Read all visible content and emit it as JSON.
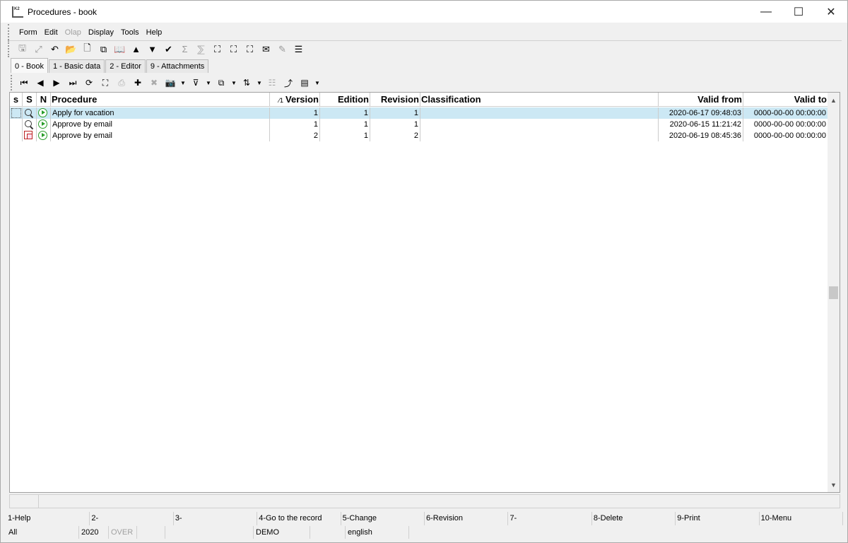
{
  "window": {
    "title": "Procedures - book",
    "icon_name": "k2-app-icon",
    "controls": {
      "minimize": "—",
      "maximize": "☐",
      "close": "✕"
    }
  },
  "menu": {
    "items": [
      {
        "label": "Form",
        "enabled": true
      },
      {
        "label": "Edit",
        "enabled": true
      },
      {
        "label": "Olap",
        "enabled": false
      },
      {
        "label": "Display",
        "enabled": true
      },
      {
        "label": "Tools",
        "enabled": true
      },
      {
        "label": "Help",
        "enabled": true
      }
    ]
  },
  "toolbar": {
    "icons": [
      {
        "name": "save-icon",
        "glyph": "🖫",
        "enabled": false
      },
      {
        "name": "save-as-icon",
        "glyph": "⤢",
        "enabled": false
      },
      {
        "name": "undo-icon",
        "glyph": "↶",
        "enabled": true
      },
      {
        "name": "open-folder-icon",
        "glyph": "📂",
        "enabled": true
      },
      {
        "name": "new-document-icon",
        "glyph": "🗋",
        "enabled": true
      },
      {
        "name": "copy-record-icon",
        "glyph": "⧉",
        "enabled": true
      },
      {
        "name": "book-icon",
        "glyph": "📖",
        "enabled": true
      },
      {
        "name": "move-up-icon",
        "glyph": "▲",
        "enabled": true
      },
      {
        "name": "move-down-icon",
        "glyph": "▼",
        "enabled": true
      },
      {
        "name": "select-check-icon",
        "glyph": "✔",
        "enabled": true
      },
      {
        "name": "sum-icon",
        "glyph": "Σ",
        "enabled": false
      },
      {
        "name": "sum-filter-icon",
        "glyph": "⅀",
        "enabled": false
      },
      {
        "name": "binoculars-icon",
        "glyph": "⛶",
        "enabled": true
      },
      {
        "name": "find-next-icon",
        "glyph": "⛶",
        "enabled": true
      },
      {
        "name": "find-replace-icon",
        "glyph": "⛶",
        "enabled": true
      },
      {
        "name": "mail-icon",
        "glyph": "✉",
        "enabled": true
      },
      {
        "name": "edit-note-icon",
        "glyph": "✎",
        "enabled": false
      },
      {
        "name": "hamburger-menu-icon",
        "glyph": "☰",
        "enabled": true
      }
    ]
  },
  "tabs": [
    {
      "label": "0 - Book",
      "active": true
    },
    {
      "label": "1 - Basic data",
      "active": false
    },
    {
      "label": "2 - Editor",
      "active": false
    },
    {
      "label": "9 - Attachments",
      "active": false
    }
  ],
  "subtoolbar": {
    "icons": [
      {
        "name": "first-record-icon",
        "glyph": "⏮",
        "enabled": true
      },
      {
        "name": "prev-record-icon",
        "glyph": "◀",
        "enabled": true
      },
      {
        "name": "next-record-icon",
        "glyph": "▶",
        "enabled": true
      },
      {
        "name": "last-record-icon",
        "glyph": "⏭",
        "enabled": true
      },
      {
        "name": "refresh-icon",
        "glyph": "⟳",
        "enabled": true
      },
      {
        "name": "binoculars-icon",
        "glyph": "⛶",
        "enabled": true
      },
      {
        "name": "print-icon",
        "glyph": "⎙",
        "enabled": false
      },
      {
        "name": "add-selection-icon",
        "glyph": "✚",
        "enabled": true
      },
      {
        "name": "remove-selection-icon",
        "glyph": "✖",
        "enabled": false
      },
      {
        "name": "camera-icon",
        "glyph": "📷",
        "enabled": true
      },
      {
        "name": "filter-icon",
        "glyph": "⊽",
        "enabled": true
      },
      {
        "name": "view-icon",
        "glyph": "⧉",
        "enabled": true
      },
      {
        "name": "sort-az-icon",
        "glyph": "⇅",
        "enabled": true
      },
      {
        "name": "tree-icon",
        "glyph": "☷",
        "enabled": false
      },
      {
        "name": "export-icon",
        "glyph": "⤴",
        "enabled": true
      },
      {
        "name": "report-icon",
        "glyph": "▤",
        "enabled": true
      }
    ]
  },
  "grid": {
    "columns": [
      {
        "key": "s_lower",
        "label": "s"
      },
      {
        "key": "s_upper",
        "label": "S"
      },
      {
        "key": "n",
        "label": "N"
      },
      {
        "key": "procedure",
        "label": "Procedure"
      },
      {
        "key": "version",
        "label": "Version",
        "sort_marker": "⁄1"
      },
      {
        "key": "edition",
        "label": "Edition"
      },
      {
        "key": "revision",
        "label": "Revision"
      },
      {
        "key": "classification",
        "label": "Classification"
      },
      {
        "key": "valid_from",
        "label": "Valid from"
      },
      {
        "key": "valid_to",
        "label": "Valid to"
      }
    ],
    "rows": [
      {
        "selected": true,
        "status_icon": "magnifier-icon",
        "procedure": "Apply for vacation",
        "version": "1",
        "edition": "1",
        "revision": "1",
        "classification": "",
        "valid_from": "2020-06-17 09:48:03",
        "valid_to": "0000-00-00 00:00:00"
      },
      {
        "selected": false,
        "status_icon": "magnifier-icon",
        "procedure": "Approve by email",
        "version": "1",
        "edition": "1",
        "revision": "1",
        "classification": "",
        "valid_from": "2020-06-15 11:21:42",
        "valid_to": "0000-00-00 00:00:00"
      },
      {
        "selected": false,
        "status_icon": "copy-icon",
        "procedure": "Approve by email",
        "version": "2",
        "edition": "1",
        "revision": "2",
        "classification": "",
        "valid_from": "2020-06-19 08:45:36",
        "valid_to": "0000-00-00 00:00:00"
      }
    ]
  },
  "function_keys": [
    "1-Help",
    "2-",
    "3-",
    "4-Go to the record",
    "5-Change",
    "6-Revision",
    "7-",
    "8-Delete",
    "9-Print",
    "10-Menu"
  ],
  "info_bar": [
    {
      "label": "All",
      "enabled": true
    },
    {
      "label": "2020",
      "enabled": true
    },
    {
      "label": "OVER",
      "enabled": false
    },
    {
      "label": "",
      "enabled": true
    },
    {
      "label": "",
      "enabled": true
    },
    {
      "label": "DEMO",
      "enabled": true
    },
    {
      "label": "",
      "enabled": true
    },
    {
      "label": "english",
      "enabled": true
    }
  ],
  "colors": {
    "selected_row": "#cce8f4",
    "play_green": "#2a9d2a"
  }
}
